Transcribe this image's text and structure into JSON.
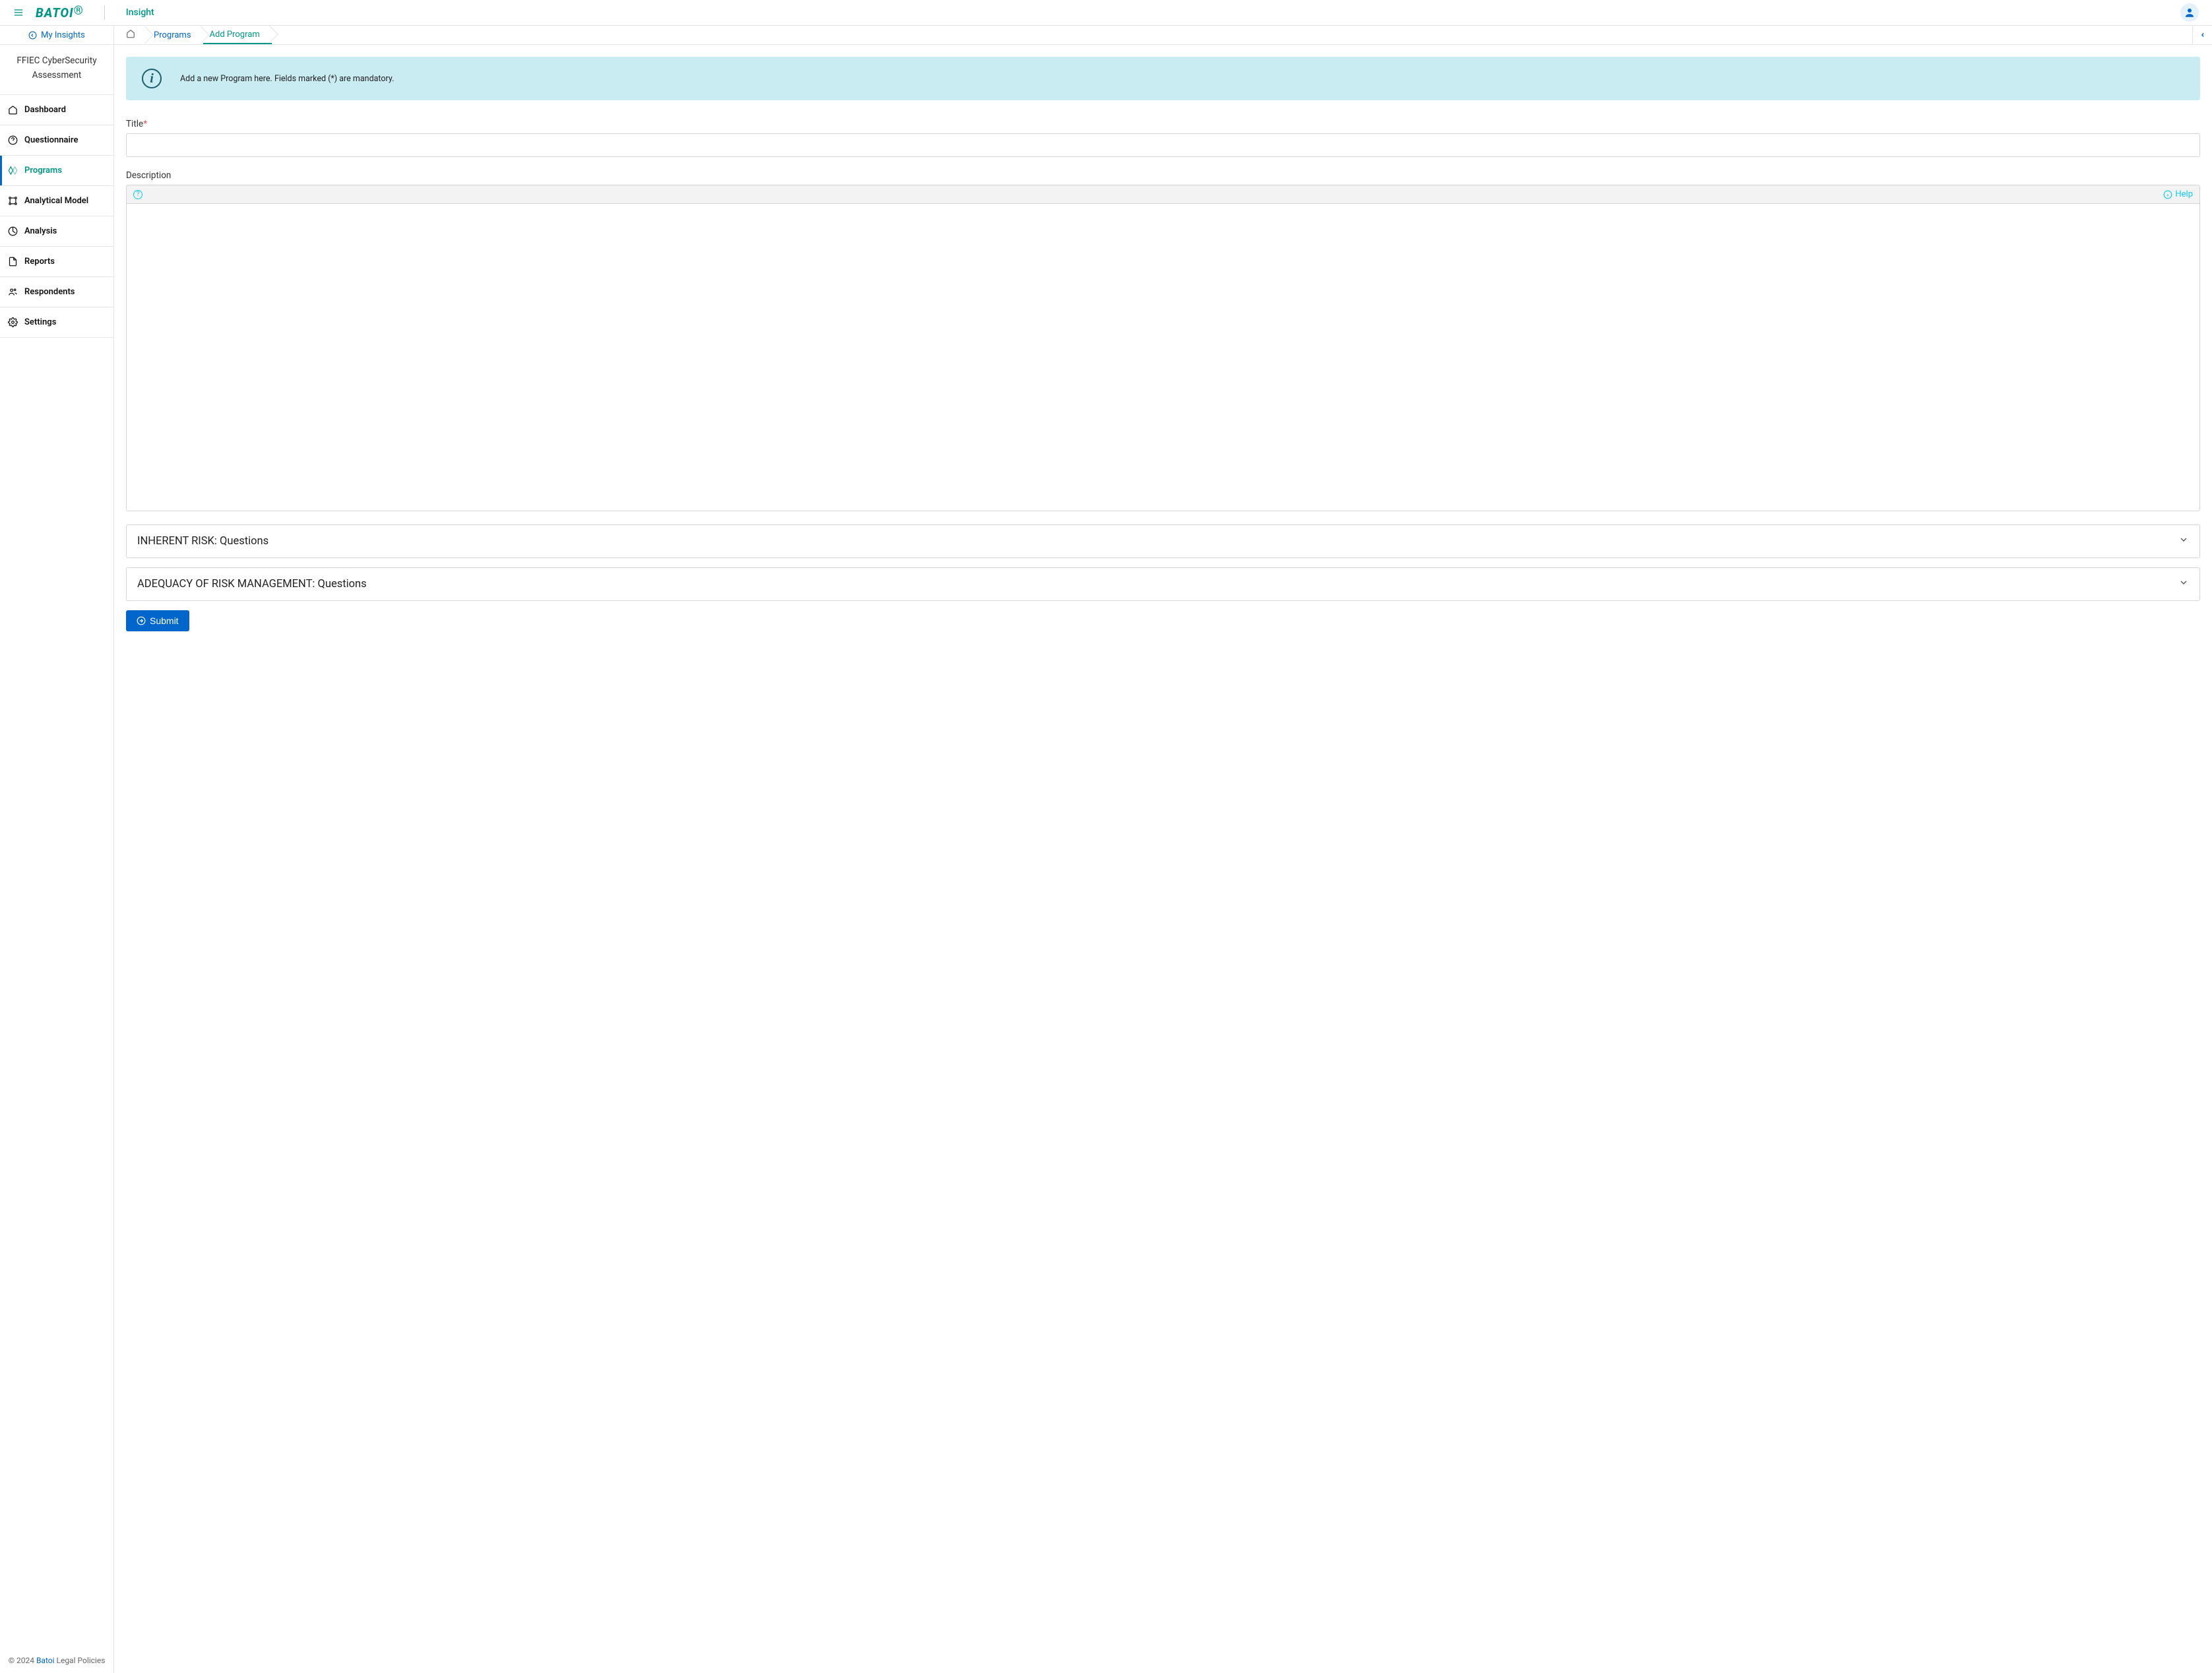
{
  "header": {
    "logo_text": "BATOI",
    "app_name": "Insight"
  },
  "sidebar": {
    "my_insights_label": "My Insights",
    "insight_name": "FFIEC CyberSecurity Assessment",
    "items": [
      {
        "label": "Dashboard"
      },
      {
        "label": "Questionnaire"
      },
      {
        "label": "Programs"
      },
      {
        "label": "Analytical Model"
      },
      {
        "label": "Analysis"
      },
      {
        "label": "Reports"
      },
      {
        "label": "Respondents"
      },
      {
        "label": "Settings"
      }
    ],
    "footer": {
      "copyright_prefix": "© 2024 ",
      "brand": "Batoi",
      "legal": " Legal Policies"
    }
  },
  "breadcrumb": {
    "items": [
      {
        "label": "Programs"
      },
      {
        "label": "Add Program"
      }
    ]
  },
  "form": {
    "info_text": "Add a new Program here. Fields marked (*) are mandatory.",
    "title_label": "Title",
    "description_label": "Description",
    "help_label": "Help",
    "accordions": [
      {
        "title": "INHERENT RISK: Questions"
      },
      {
        "title": "ADEQUACY OF RISK MANAGEMENT: Questions"
      }
    ],
    "submit_label": "Submit"
  }
}
